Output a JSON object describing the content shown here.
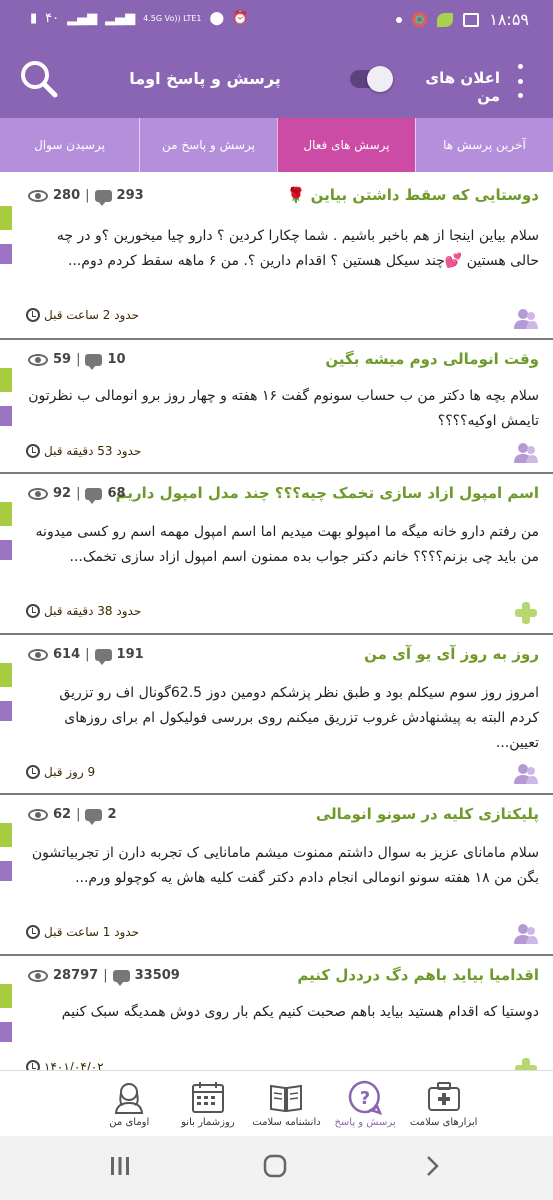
{
  "status_bar": {
    "time": "۱۸:۵۹",
    "battery": "۴۰",
    "network": "4.5G Vo)) LTE1"
  },
  "app_bar": {
    "title": "پرسش و پاسخ اوما",
    "notifications_label": "اعلان های من",
    "icons": [
      "more-vert-icon",
      "toggle-switch",
      "search-icon"
    ]
  },
  "tabs": [
    {
      "label": "آخرین پرسش ها",
      "active": false
    },
    {
      "label": "پرسش های فعال",
      "active": true
    },
    {
      "label": "پرسش و پاسخ من",
      "active": false
    },
    {
      "label": "پرسیدن سوال",
      "active": false
    }
  ],
  "questions": [
    {
      "title": "دوستایی که سقط داشتن بیاین 🌹",
      "views": "280",
      "comments": "293",
      "body": "سلام بیاین اینجا از هم باخبر باشیم . شما چکارا کردین ؟ دارو چیا میخورین ؟و در چه حالی هستین 💕چند سیکل هستین ؟ اقدام دارین ؟.  من ۶ ماهه سقط کردم دوم...",
      "time": "حدود 2 ساعت قبل",
      "avatar": "user-icon"
    },
    {
      "title": "وقت انومالی دوم میشه بگین",
      "views": "59",
      "comments": "10",
      "body": "سلام بچه ها دکتر من ب حساب سونوم گفت ۱۶ هفته و چهار روز برو انومالی ب نظرتون تایمش اوکیه؟؟؟؟",
      "time": "حدود 53 دقیقه قبل",
      "avatar": "user-icon"
    },
    {
      "title": "اسم امپول ازاد سازی تخمک چیه؟؟؟ چند مدل امپول داریم",
      "views": "92",
      "comments": "68",
      "body": "من رفتم دارو خانه میگه ما امپولو بهت میدیم اما اسم امپول مهمه  اسم رو کسی میدونه من باید چی بزنم؟؟؟؟ خانم دکتر جواب بده ممنون اسم امپول ازاد سازی تخمک...",
      "time": "حدود 38 دقیقه قبل",
      "avatar": "plus-icon"
    },
    {
      "title": "روز به روز آی یو آی من",
      "views": "614",
      "comments": "191",
      "body": "امروز روز سوم سیکلم بود و طبق نظر پزشکم دومین دوز 62.5گونال اف رو تزریق کردم البته به پیشنهادش غروب تزریق میکنم روی بررسی فولیکول ام برای روزهای تعیین...",
      "time": "9 روز قبل",
      "avatar": "user-icon"
    },
    {
      "title": "پلیکتازی کلیه در سونو انومالی",
      "views": "62",
      "comments": "2",
      "body": "سلام مامانای عزیز به سوال داشتم ممنوت میشم مامانایی ک تجربه دارن از تجربیاتشون بگن  من ۱۸ هفته سونو انومالی انجام دادم دکتر گفت کلیه هاش یه کوچولو ورم...",
      "time": "حدود 1 ساعت قبل",
      "avatar": "user-icon"
    },
    {
      "title": "اقدامیا بیاید باهم دگ درددل کنیم",
      "views": "28797",
      "comments": "33509",
      "body": "دوستیا که اقدام هستید بیاید باهم صحبت کنیم یکم بار روی دوش همدیگه سبک کنیم",
      "time": "۱۴۰۱/۰۴/۰۲",
      "avatar": "plus-icon"
    }
  ],
  "bottom_nav": [
    {
      "label": "ابزارهای سلامت",
      "icon": "first-aid-kit-icon",
      "active": false
    },
    {
      "label": "پرسش و پاسخ",
      "icon": "question-bubble-icon",
      "active": true
    },
    {
      "label": "دانشنامه سلامت",
      "icon": "book-icon",
      "active": false
    },
    {
      "label": "روزشمار بانو",
      "icon": "calendar-icon",
      "active": false
    },
    {
      "label": "اومای من",
      "icon": "woman-profile-icon",
      "active": false
    }
  ],
  "colors": {
    "primary": "#8a65b4",
    "tab_bg": "#b68fdc",
    "tab_active": "#cc4ba5",
    "title_green": "#6f9a2a",
    "accent_green": "#a7cc3f",
    "accent_purple": "#9b73c3"
  }
}
